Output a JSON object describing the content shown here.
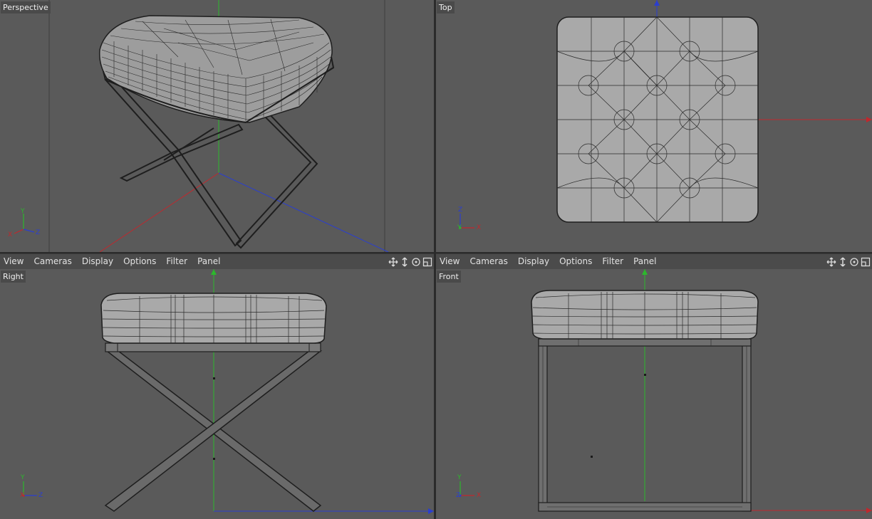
{
  "viewports": {
    "perspective": {
      "label": "Perspective"
    },
    "top": {
      "label": "Top"
    },
    "right": {
      "label": "Right"
    },
    "front": {
      "label": "Front"
    }
  },
  "menu": {
    "view": "View",
    "cameras": "Cameras",
    "display": "Display",
    "options": "Options",
    "filter": "Filter",
    "panel": "Panel"
  },
  "axis_labels": {
    "x": "X",
    "y": "Y",
    "z": "Z"
  },
  "colors": {
    "viewport_bg": "#5a5a5a",
    "menubar_bg": "#4b4b4b",
    "axis_x": "#c0282d",
    "axis_y": "#2cb82c",
    "axis_z": "#2a3ed0",
    "wire": "#1e1e1e",
    "surface": "#a8a8a8"
  },
  "icons": [
    "move-view-icon",
    "scroll-view-icon",
    "rotate-view-icon",
    "maximize-view-icon"
  ]
}
